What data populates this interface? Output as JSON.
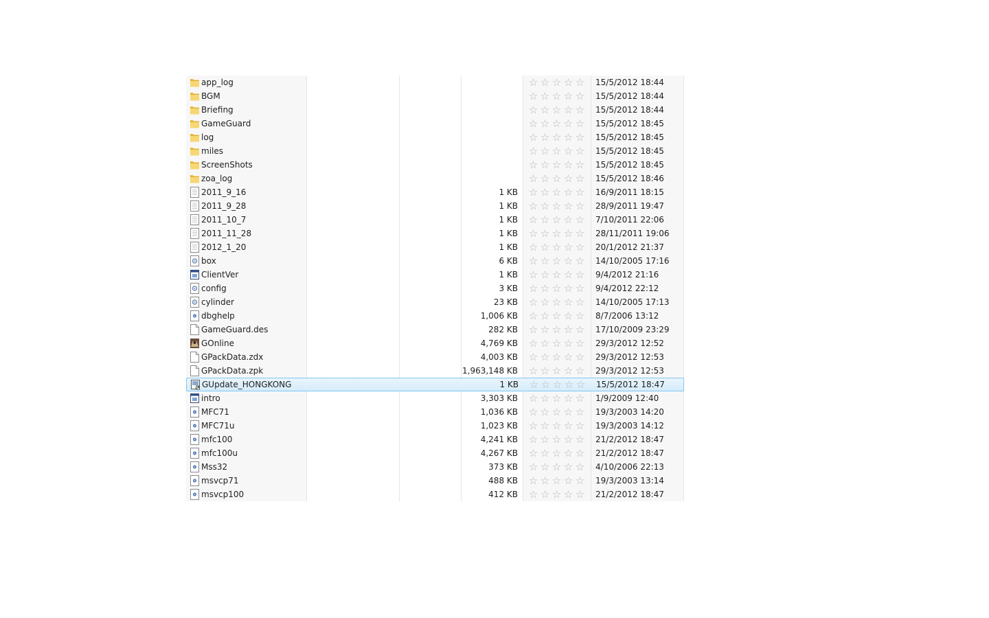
{
  "files": [
    {
      "name": "app_log",
      "size": "",
      "date": "15/5/2012 18:44",
      "icon": "folder-icon"
    },
    {
      "name": "BGM",
      "size": "",
      "date": "15/5/2012 18:44",
      "icon": "folder-icon"
    },
    {
      "name": "Briefing",
      "size": "",
      "date": "15/5/2012 18:44",
      "icon": "folder-icon"
    },
    {
      "name": "GameGuard",
      "size": "",
      "date": "15/5/2012 18:45",
      "icon": "folder-icon"
    },
    {
      "name": "log",
      "size": "",
      "date": "15/5/2012 18:45",
      "icon": "folder-icon"
    },
    {
      "name": "miles",
      "size": "",
      "date": "15/5/2012 18:45",
      "icon": "folder-icon"
    },
    {
      "name": "ScreenShots",
      "size": "",
      "date": "15/5/2012 18:45",
      "icon": "folder-icon"
    },
    {
      "name": "zoa_log",
      "size": "",
      "date": "15/5/2012 18:46",
      "icon": "folder-icon"
    },
    {
      "name": "2011_9_16",
      "size": "1 KB",
      "date": "16/9/2011 18:15",
      "icon": "text-file-icon"
    },
    {
      "name": "2011_9_28",
      "size": "1 KB",
      "date": "28/9/2011 19:47",
      "icon": "text-file-icon"
    },
    {
      "name": "2011_10_7",
      "size": "1 KB",
      "date": "7/10/2011 22:06",
      "icon": "text-file-icon"
    },
    {
      "name": "2011_11_28",
      "size": "1 KB",
      "date": "28/11/2011 19:06",
      "icon": "text-file-icon"
    },
    {
      "name": "2012_1_20",
      "size": "1 KB",
      "date": "20/1/2012 21:37",
      "icon": "text-file-icon"
    },
    {
      "name": "box",
      "size": "6 KB",
      "date": "14/10/2005 17:16",
      "icon": "settings-file-icon"
    },
    {
      "name": "ClientVer",
      "size": "1 KB",
      "date": "9/4/2012 21:16",
      "icon": "app-file-icon"
    },
    {
      "name": "config",
      "size": "3 KB",
      "date": "9/4/2012 22:12",
      "icon": "settings-file-icon"
    },
    {
      "name": "cylinder",
      "size": "23 KB",
      "date": "14/10/2005 17:13",
      "icon": "settings-file-icon"
    },
    {
      "name": "dbghelp",
      "size": "1,006 KB",
      "date": "8/7/2006 13:12",
      "icon": "dll-file-icon"
    },
    {
      "name": "GameGuard.des",
      "size": "282 KB",
      "date": "17/10/2009 23:29",
      "icon": "blank-file-icon"
    },
    {
      "name": "GOnline",
      "size": "4,769 KB",
      "date": "29/3/2012 12:52",
      "icon": "game-app-icon"
    },
    {
      "name": "GPackData.zdx",
      "size": "4,003 KB",
      "date": "29/3/2012 12:53",
      "icon": "blank-file-icon"
    },
    {
      "name": "GPackData.zpk",
      "size": "1,963,148 KB",
      "date": "29/3/2012 12:53",
      "icon": "blank-file-icon"
    },
    {
      "name": "GUpdate_HONGKONG",
      "size": "1 KB",
      "date": "15/5/2012 18:47",
      "icon": "shortcut-file-icon",
      "selected": true
    },
    {
      "name": "intro",
      "size": "3,303 KB",
      "date": "1/9/2009 12:40",
      "icon": "app-file-icon"
    },
    {
      "name": "MFC71",
      "size": "1,036 KB",
      "date": "19/3/2003 14:20",
      "icon": "dll-file-icon"
    },
    {
      "name": "MFC71u",
      "size": "1,023 KB",
      "date": "19/3/2003 14:12",
      "icon": "dll-file-icon"
    },
    {
      "name": "mfc100",
      "size": "4,241 KB",
      "date": "21/2/2012 18:47",
      "icon": "dll-file-icon"
    },
    {
      "name": "mfc100u",
      "size": "4,267 KB",
      "date": "21/2/2012 18:47",
      "icon": "dll-file-icon"
    },
    {
      "name": "Mss32",
      "size": "373 KB",
      "date": "4/10/2006 22:13",
      "icon": "dll-file-icon"
    },
    {
      "name": "msvcp71",
      "size": "488 KB",
      "date": "19/3/2003 13:14",
      "icon": "dll-file-icon"
    },
    {
      "name": "msvcp100",
      "size": "412 KB",
      "date": "21/2/2012 18:47",
      "icon": "dll-file-icon"
    }
  ],
  "rating_stars": 5,
  "rating_star_glyph": "☆",
  "colors": {
    "folder": "#f2c94c",
    "selection_border": "#84c6f1",
    "selection_fill": "#dbeefc",
    "star": "#b4b4b4",
    "column_shade": "#f7f7f7"
  }
}
